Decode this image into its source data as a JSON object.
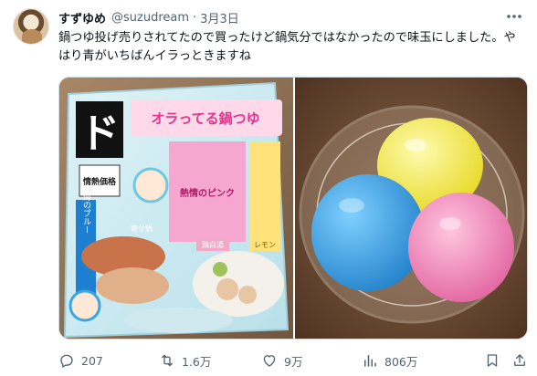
{
  "author": {
    "display_name": "すずゆめ",
    "handle": "@suzudream",
    "separator": "·",
    "date": "3月3日"
  },
  "tweet": {
    "text": "鍋つゆ投げ売りされてたので買ったけど鍋気分ではなかったので味玉にしました。やはり青がいちばんイラっときますね"
  },
  "package": {
    "logo_text": "ド",
    "title": "オラってる鍋つゆ",
    "badge": "情熱価格",
    "blue_label": "青海のブルー",
    "pink_label": "熱情のピンク",
    "lemon_label": "レモン",
    "seafood_label": "寄せ鍋",
    "pork_label": "鶏白湯"
  },
  "actions": {
    "reply_count": "207",
    "retweet_count": "1.6万",
    "like_count": "9万",
    "view_count": "806万"
  },
  "icons": {
    "more": "more-dots-icon",
    "reply": "reply-icon",
    "retweet": "retweet-icon",
    "like": "heart-icon",
    "views": "views-chart-icon",
    "bookmark": "bookmark-icon",
    "share": "share-icon"
  },
  "colors": {
    "text": "#0f1419",
    "secondary": "#536471",
    "border": "#cfd9de",
    "egg_blue": "#3aa7e4",
    "egg_yellow": "#f2e640",
    "egg_pink": "#f07bb1"
  }
}
